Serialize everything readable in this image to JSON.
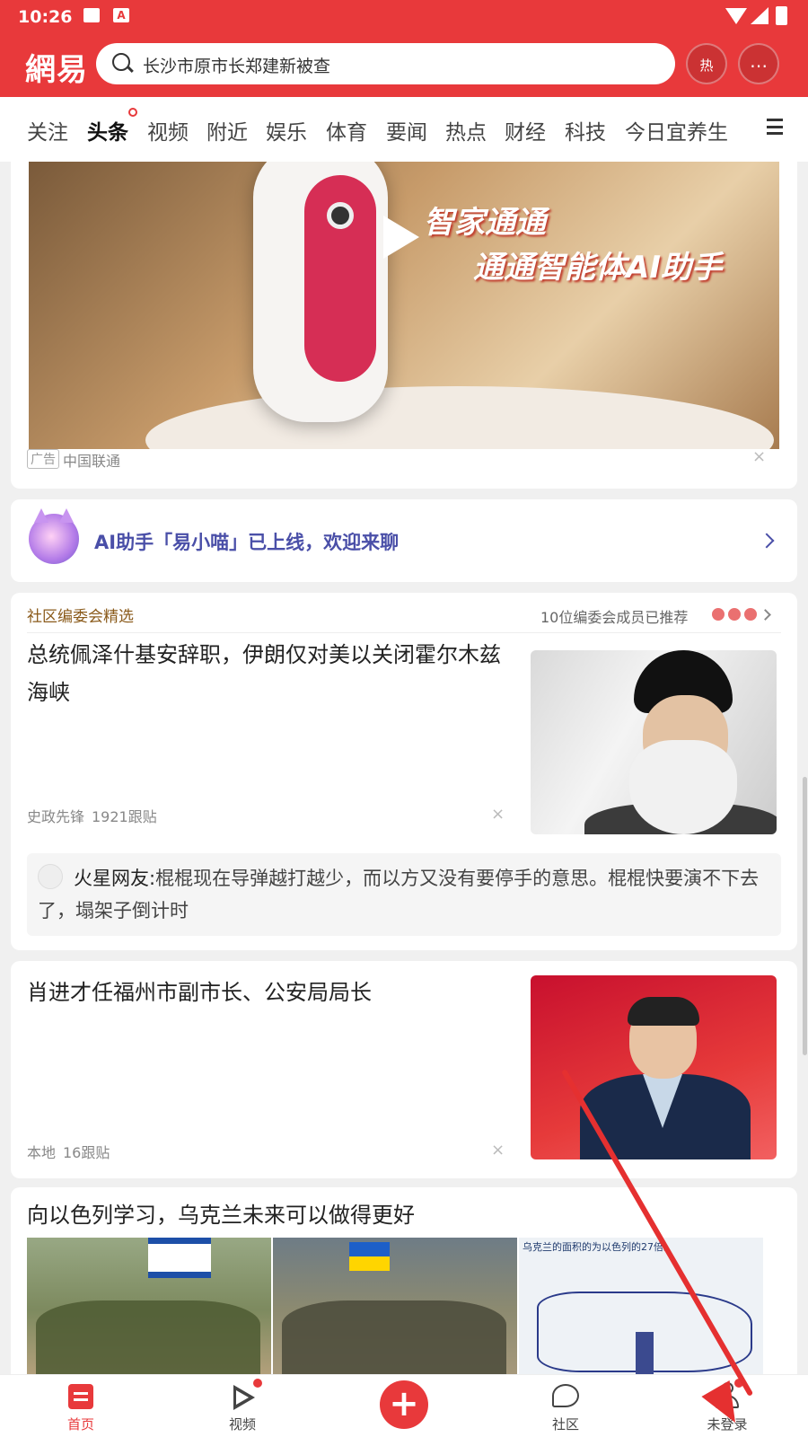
{
  "status_bar": {
    "time": "10:26",
    "notif_icon_a": "A"
  },
  "header": {
    "logo": "網易",
    "search_query": "长沙市原市长郑建新被查",
    "hot_label": "热",
    "brand_color": "#e8393b"
  },
  "tabs": [
    "关注",
    "头条",
    "视频",
    "附近",
    "娱乐",
    "体育",
    "要闻",
    "热点",
    "财经",
    "科技",
    "今日宜养生"
  ],
  "active_tab": "头条",
  "ad": {
    "line1": "智家通通",
    "line2": "通通智能体AI助手",
    "badge": "广告",
    "source": "中国联通",
    "close": "×"
  },
  "ai_banner": {
    "text": "AI助手「易小喵」已上线，欢迎来聊"
  },
  "feed": {
    "section_title": "社区编委会精选",
    "section_right": "10位编委会成员已推荐",
    "item1": {
      "title": "总统佩泽什基安辞职，伊朗仅对美以关闭霍尔木兹海峡",
      "source": "史政先锋",
      "comments": "1921跟贴",
      "comment_user": "火星网友:",
      "comment_text": "棍棍现在导弹越打越少，而以方又没有要停手的意思。棍棍快要演不下去了，塌架子倒计时"
    },
    "item2": {
      "title": "肖进才任福州市副市长、公安局局长",
      "source": "本地",
      "comments": "16跟贴"
    },
    "item3": {
      "title": "向以色列学习，乌克兰未来可以做得更好",
      "map_caption": "乌克兰的面积的为以色列的27倍。"
    }
  },
  "bottom_nav": {
    "home": "首页",
    "video": "视频",
    "plus": "+",
    "community": "社区",
    "login": "未登录"
  }
}
